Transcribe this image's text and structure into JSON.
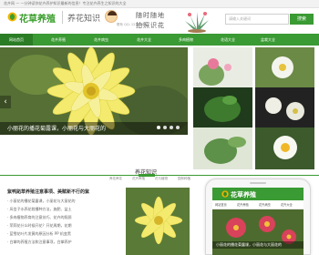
{
  "topbar": {
    "text": "花卉网 — 一分钟读你花卉养护知识最新的信息！专注花卉养生之知识的大全"
  },
  "header": {
    "logo_text": "花草养殖",
    "logo_sub": "养花知识",
    "contact": "联系 QQ: 1234567",
    "slogan_line1": "随时随地",
    "slogan_line2": "拍照识花",
    "search_placeholder": "请输入关键词",
    "search_button": "搜索"
  },
  "nav": {
    "items": [
      {
        "label": "网站首页",
        "active": true
      },
      {
        "label": "花卉养殖",
        "active": false
      },
      {
        "label": "花卉病虫",
        "active": false
      },
      {
        "label": "花卉大全",
        "active": false
      },
      {
        "label": "多肉植物",
        "active": false
      },
      {
        "label": "花语大全",
        "active": false
      },
      {
        "label": "盆栽大全",
        "active": false
      }
    ]
  },
  "slider": {
    "caption": "小丽花的播花菊露课，小丽花与大丽花的"
  },
  "section": {
    "title": "养花知识",
    "tabs": [
      "养花养花",
      "花卉养殖",
      "花与植物",
      "园林种植"
    ]
  },
  "article": {
    "title": "紫鸭跖草养殖注意事项、美赋新不行的紫",
    "lines": [
      "· 小丽花的播花菊露课，小丽花与大丽花的",
      "· 风信子水养花栽播种方法，施肥、盆土",
      "· 多肉植物养育的注意技巧、花卉的照顾",
      "· 茉莉花什么时候开花？开花周期，花期",
      "· 蓝雪花叶片发黄的原因分析 PP 机变黑",
      "· 白掌的养殖方法和注意事项，白掌养护"
    ]
  },
  "phone": {
    "logo": "花草养殖",
    "nav": [
      "网站首页",
      "花卉养殖",
      "花卉病虫",
      "花卉大全"
    ],
    "caption": "小丽花的播花菊露课，小丽花与大丽花的"
  },
  "colors": {
    "brand": "#3a9a33",
    "brand_dark": "#2b7d25"
  }
}
